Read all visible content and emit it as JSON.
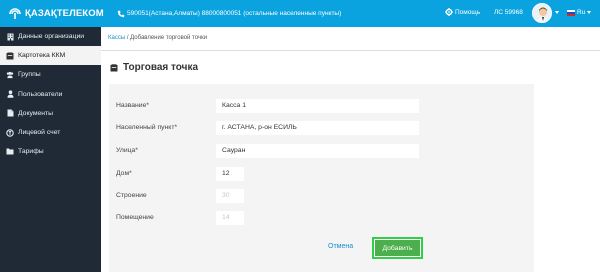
{
  "header": {
    "brand": "ҚАЗАҚТЕЛЕКОМ",
    "contact": "590051(Астана,Алматы) 88000800051 (остальные населенные пункты)",
    "help": "Помощь",
    "account": "ЛС 59968",
    "language": "Ru"
  },
  "sidebar": {
    "items": [
      {
        "label": "Данные организации",
        "icon": "building-icon"
      },
      {
        "label": "Картотека ККМ",
        "icon": "card-file-icon"
      },
      {
        "label": "Группы",
        "icon": "users-group-icon"
      },
      {
        "label": "Пользователи",
        "icon": "user-icon"
      },
      {
        "label": "Документы",
        "icon": "document-icon"
      },
      {
        "label": "Лицевой счет",
        "icon": "bill-icon"
      },
      {
        "label": "Тарифы",
        "icon": "folder-icon"
      }
    ],
    "active_index": 1
  },
  "breadcrumb": {
    "link": "Кассы",
    "separator": " / ",
    "current": "Добавление торговой точки"
  },
  "page": {
    "title": "Торговая точка"
  },
  "form": {
    "fields": [
      {
        "label": "Название*",
        "value": "Касса 1"
      },
      {
        "label": "Населенный пункт*",
        "value": "г. АСТАНА,  р-он ЕСИЛЬ"
      },
      {
        "label": "Улица*",
        "value": "Сауран"
      },
      {
        "label": "Дом*",
        "value": "12"
      },
      {
        "label": "Строение",
        "placeholder": "30"
      },
      {
        "label": "Помещение",
        "placeholder": "14"
      }
    ],
    "cancel_label": "Отмена",
    "submit_label": "Добавить"
  },
  "colors": {
    "topbar": "#0aa3df",
    "sidebar": "#1f2a36",
    "submit": "#4cae4c",
    "submit_highlight": "#2dd243",
    "link": "#1a8fcc"
  }
}
